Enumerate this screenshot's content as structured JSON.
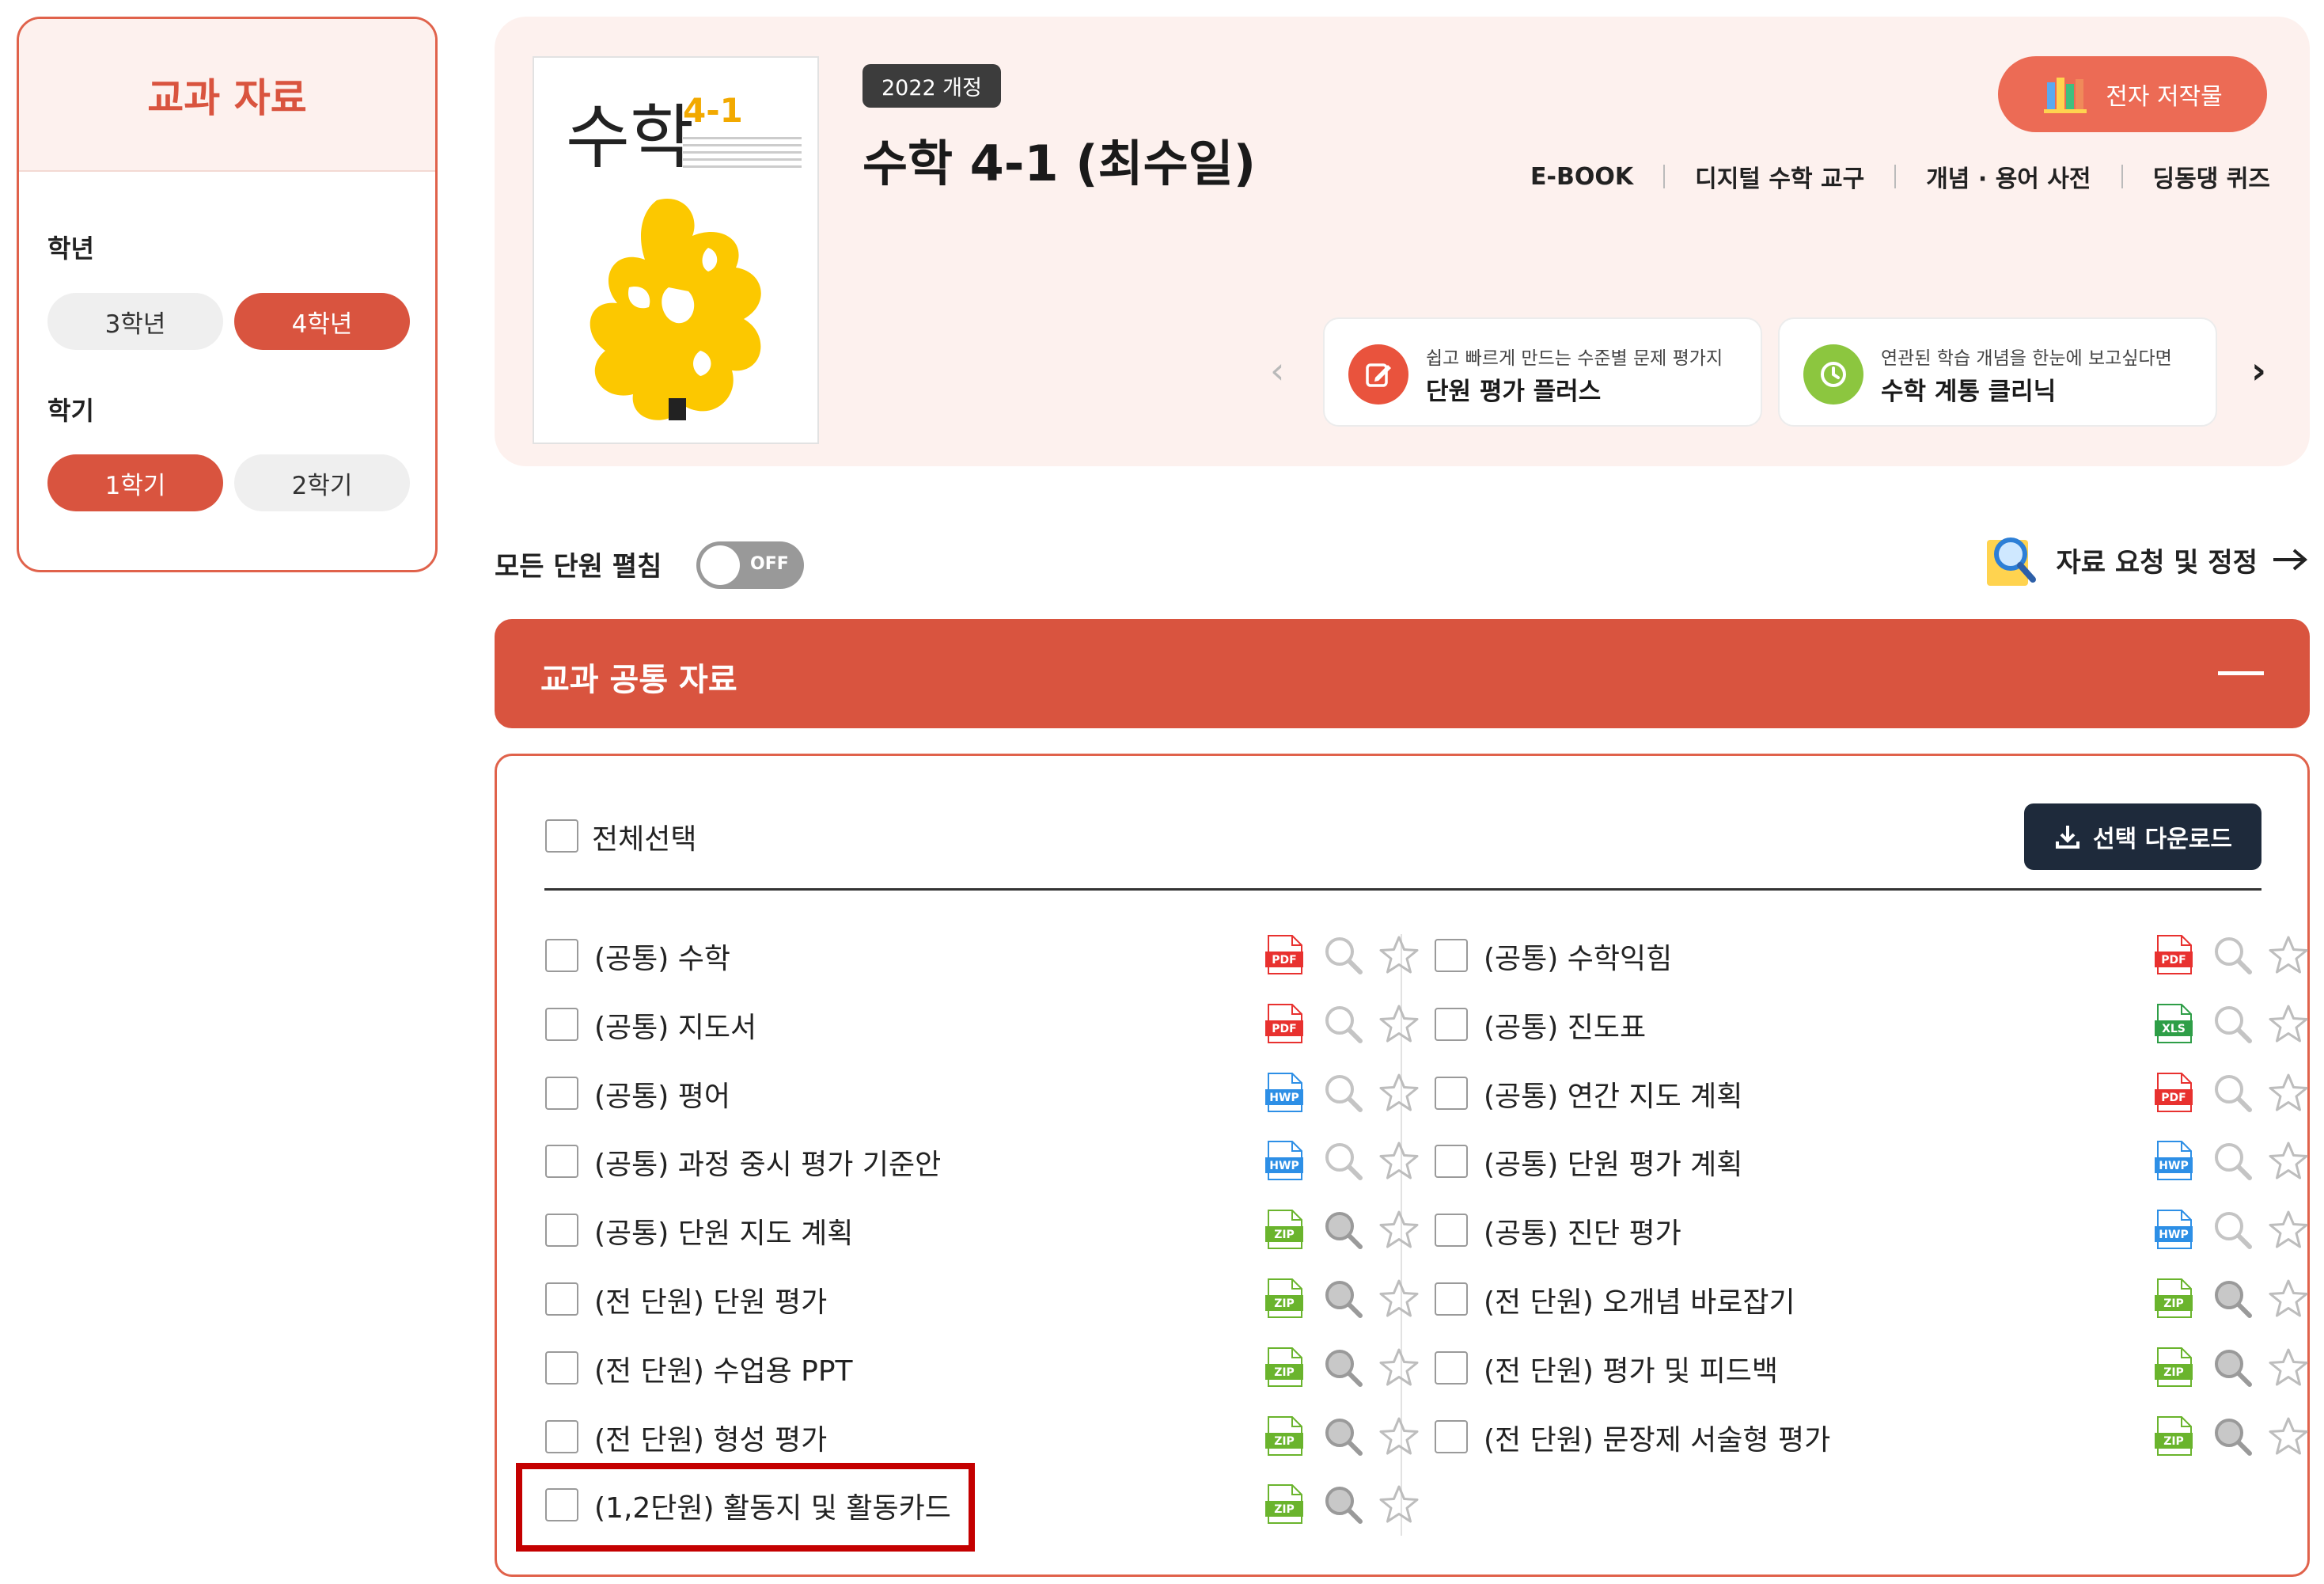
{
  "sidebar": {
    "title": "교과 자료",
    "grade_label": "학년",
    "grades": [
      "3학년",
      "4학년"
    ],
    "grade_selected": "4학년",
    "semester_label": "학기",
    "semesters": [
      "1학기",
      "2학기"
    ],
    "semester_selected": "1학기"
  },
  "header": {
    "cover_title": "수학",
    "cover_grade": "4-1",
    "badge": "2022 개정",
    "title": "수학 4-1 (최수일)",
    "ebook_label": "전자 저작물",
    "links": [
      "E-BOOK",
      "디지털 수학 교구",
      "개념 · 용어 사전",
      "딩동댕 퀴즈"
    ],
    "promos": [
      {
        "sub": "쉽고 빠르게 만드는 수준별 문제 평가지",
        "main": "단원 평가 플러스",
        "color": "#e9533d",
        "icon": "edit-icon"
      },
      {
        "sub": "연관된 학습 개념을 한눈에 보고싶다면",
        "main": "수학 계통 클리닉",
        "color": "#8cc63f",
        "icon": "cycle-icon"
      }
    ],
    "brand_color": "#d9543f"
  },
  "controls": {
    "expand_all_label": "모든 단원 펼침",
    "toggle_text": "OFF",
    "toggle_on": false,
    "request_label": "자료 요청 및 정정"
  },
  "section": {
    "title": "교과 공통 자료",
    "select_all_label": "전체선택",
    "download_label": "선택 다운로드"
  },
  "materials_left": [
    {
      "label": "(공통) 수학",
      "type": "PDF"
    },
    {
      "label": "(공통) 지도서",
      "type": "PDF"
    },
    {
      "label": "(공통) 평어",
      "type": "HWP"
    },
    {
      "label": "(공통) 과정 중시 평가 기준안",
      "type": "HWP"
    },
    {
      "label": "(공통) 단원 지도 계획",
      "type": "ZIP"
    },
    {
      "label": "(전 단원) 단원 평가",
      "type": "ZIP"
    },
    {
      "label": "(전 단원) 수업용 PPT",
      "type": "ZIP"
    },
    {
      "label": "(전 단원) 형성 평가",
      "type": "ZIP"
    },
    {
      "label": "(1,2단원) 활동지 및 활동카드",
      "type": "ZIP"
    }
  ],
  "materials_right": [
    {
      "label": "(공통) 수학익힘",
      "type": "PDF"
    },
    {
      "label": "(공통) 진도표",
      "type": "XLS"
    },
    {
      "label": "(공통) 연간 지도 계획",
      "type": "PDF"
    },
    {
      "label": "(공통) 단원 평가 계획",
      "type": "HWP"
    },
    {
      "label": "(공통) 진단 평가",
      "type": "HWP"
    },
    {
      "label": "(전 단원) 오개념 바로잡기",
      "type": "ZIP"
    },
    {
      "label": "(전 단원) 평가 및 피드백",
      "type": "ZIP"
    },
    {
      "label": "(전 단원) 문장제 서술형 평가",
      "type": "ZIP"
    }
  ],
  "file_colors": {
    "PDF": "#e8312f",
    "HWP": "#2d8fe6",
    "ZIP": "#6ab42d",
    "XLS": "#2e9e47"
  }
}
